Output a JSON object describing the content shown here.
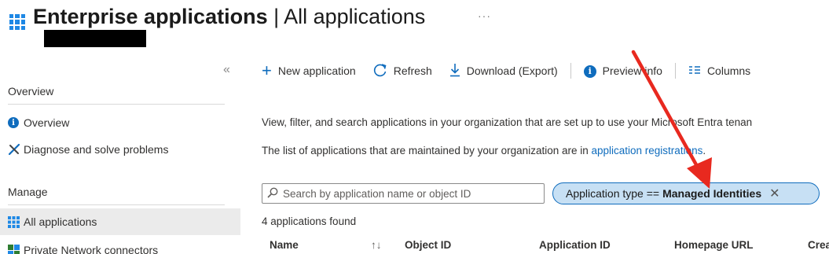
{
  "header": {
    "title_bold": "Enterprise applications",
    "title_rest": " | All applications",
    "more": "···"
  },
  "sidebar": {
    "collapse": "«",
    "sections": [
      {
        "label": "Overview"
      },
      {
        "label": "Manage"
      }
    ],
    "items": [
      {
        "label": "Overview",
        "icon": "info-icon"
      },
      {
        "label": "Diagnose and solve problems",
        "icon": "wrench-icon"
      },
      {
        "label": "All applications",
        "icon": "grid-icon",
        "active": true
      },
      {
        "label": "Private Network connectors",
        "icon": "connector-icon"
      }
    ]
  },
  "toolbar": {
    "new_application": "New application",
    "refresh": "Refresh",
    "download": "Download (Export)",
    "preview_info": "Preview info",
    "columns": "Columns"
  },
  "description": {
    "line1": "View, filter, and search applications in your organization that are set up to use your Microsoft Entra tenan",
    "line2_prefix": "The list of applications that are maintained by your organization are in ",
    "line2_link": "application registrations",
    "line2_suffix": "."
  },
  "search": {
    "placeholder": "Search by application name or object ID",
    "value": ""
  },
  "filter": {
    "prefix": "Application type == ",
    "value": "Managed Identities",
    "close": "✕"
  },
  "results_count": "4 applications found",
  "table": {
    "columns": [
      {
        "label": "Name"
      },
      {
        "label": "↑↓"
      },
      {
        "label": "Object ID"
      },
      {
        "label": "Application ID"
      },
      {
        "label": "Homepage URL"
      },
      {
        "label": "Crea"
      }
    ]
  },
  "colors": {
    "accent": "#0f6cbd",
    "filter_bg": "#c7e0f4",
    "active_bg": "#ebebeb",
    "arrow": "#e8291f"
  }
}
